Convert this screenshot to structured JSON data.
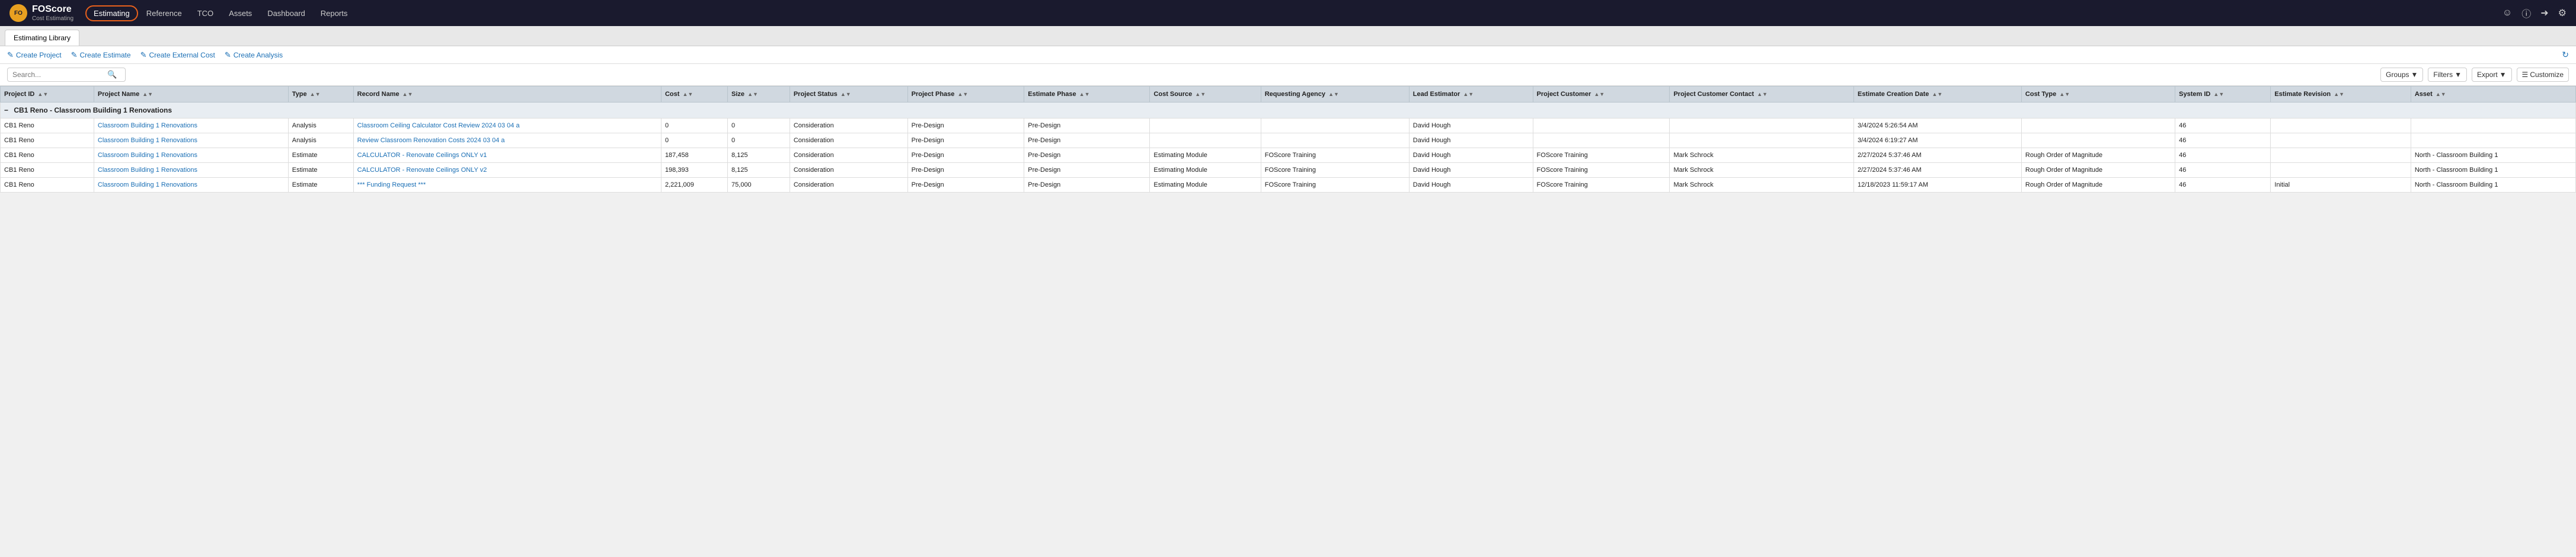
{
  "header": {
    "logo_main": "FOScore",
    "logo_sub": "Cost Estimating",
    "nav_items": [
      {
        "label": "Estimating",
        "active": true
      },
      {
        "label": "Reference",
        "active": false
      },
      {
        "label": "TCO",
        "active": false
      },
      {
        "label": "Assets",
        "active": false
      },
      {
        "label": "Dashboard",
        "active": false
      },
      {
        "label": "Reports",
        "active": false
      }
    ]
  },
  "tabs": [
    {
      "label": "Estimating Library"
    }
  ],
  "toolbar": {
    "create_project": "Create Project",
    "create_estimate": "Create Estimate",
    "create_external_cost": "Create External Cost",
    "create_analysis": "Create Analysis",
    "refresh_icon": "↻"
  },
  "search": {
    "placeholder": "Search...",
    "groups_label": "Groups",
    "filters_label": "Filters",
    "export_label": "Export",
    "customize_label": "Customize"
  },
  "table": {
    "columns": [
      "Project ID",
      "Project Name",
      "Type",
      "Record Name",
      "Cost",
      "Size",
      "Project Status",
      "Project Phase",
      "Estimate Phase",
      "Cost Source",
      "Requesting Agency",
      "Lead Estimator",
      "Project Customer",
      "Project Customer Contact",
      "Estimate Creation Date",
      "Cost Type",
      "System ID",
      "Estimate Revision",
      "Asset"
    ],
    "group_label": "CB1 Reno - Classroom Building 1 Renovations",
    "rows": [
      {
        "project_id": "CB1 Reno",
        "project_name": "Classroom Building 1 Renovations",
        "type": "Analysis",
        "record_name": "Classroom Ceiling Calculator Cost Review 2024 03 04 a",
        "cost": "0",
        "size": "0",
        "project_status": "Consideration",
        "project_phase": "Pre-Design",
        "estimate_phase": "Pre-Design",
        "cost_source": "",
        "requesting_agency": "",
        "lead_estimator": "David Hough",
        "project_customer": "",
        "project_customer_contact": "",
        "estimate_creation_date": "3/4/2024 5:26:54 AM",
        "cost_type": "",
        "system_id": "46",
        "estimate_revision": "",
        "asset": ""
      },
      {
        "project_id": "CB1 Reno",
        "project_name": "Classroom Building 1 Renovations",
        "type": "Analysis",
        "record_name": "Review Classroom Renovation Costs 2024 03 04 a",
        "cost": "0",
        "size": "0",
        "project_status": "Consideration",
        "project_phase": "Pre-Design",
        "estimate_phase": "Pre-Design",
        "cost_source": "",
        "requesting_agency": "",
        "lead_estimator": "David Hough",
        "project_customer": "",
        "project_customer_contact": "",
        "estimate_creation_date": "3/4/2024 6:19:27 AM",
        "cost_type": "",
        "system_id": "46",
        "estimate_revision": "",
        "asset": ""
      },
      {
        "project_id": "CB1 Reno",
        "project_name": "Classroom Building 1 Renovations",
        "type": "Estimate",
        "record_name": "CALCULATOR - Renovate Ceilings ONLY v1",
        "cost": "187,458",
        "size": "8,125",
        "project_status": "Consideration",
        "project_phase": "Pre-Design",
        "estimate_phase": "Pre-Design",
        "cost_source": "Estimating Module",
        "requesting_agency": "FOScore Training",
        "lead_estimator": "David Hough",
        "project_customer": "FOScore Training",
        "project_customer_contact": "Mark Schrock",
        "estimate_creation_date": "2/27/2024 5:37:46 AM",
        "cost_type": "Rough Order of Magnitude",
        "system_id": "46",
        "estimate_revision": "",
        "asset": "North - Classroom Building 1"
      },
      {
        "project_id": "CB1 Reno",
        "project_name": "Classroom Building 1 Renovations",
        "type": "Estimate",
        "record_name": "CALCULATOR - Renovate Ceilings ONLY v2",
        "cost": "198,393",
        "size": "8,125",
        "project_status": "Consideration",
        "project_phase": "Pre-Design",
        "estimate_phase": "Pre-Design",
        "cost_source": "Estimating Module",
        "requesting_agency": "FOScore Training",
        "lead_estimator": "David Hough",
        "project_customer": "FOScore Training",
        "project_customer_contact": "Mark Schrock",
        "estimate_creation_date": "2/27/2024 5:37:46 AM",
        "cost_type": "Rough Order of Magnitude",
        "system_id": "46",
        "estimate_revision": "",
        "asset": "North - Classroom Building 1"
      },
      {
        "project_id": "CB1 Reno",
        "project_name": "Classroom Building 1 Renovations",
        "type": "Estimate",
        "record_name": "*** Funding Request ***",
        "cost": "2,221,009",
        "size": "75,000",
        "project_status": "Consideration",
        "project_phase": "Pre-Design",
        "estimate_phase": "Pre-Design",
        "cost_source": "Estimating Module",
        "requesting_agency": "FOScore Training",
        "lead_estimator": "David Hough",
        "project_customer": "FOScore Training",
        "project_customer_contact": "Mark Schrock",
        "estimate_creation_date": "12/18/2023 11:59:17 AM",
        "cost_type": "Rough Order of Magnitude",
        "system_id": "46",
        "estimate_revision": "Initial",
        "asset": "North - Classroom Building 1"
      }
    ]
  }
}
